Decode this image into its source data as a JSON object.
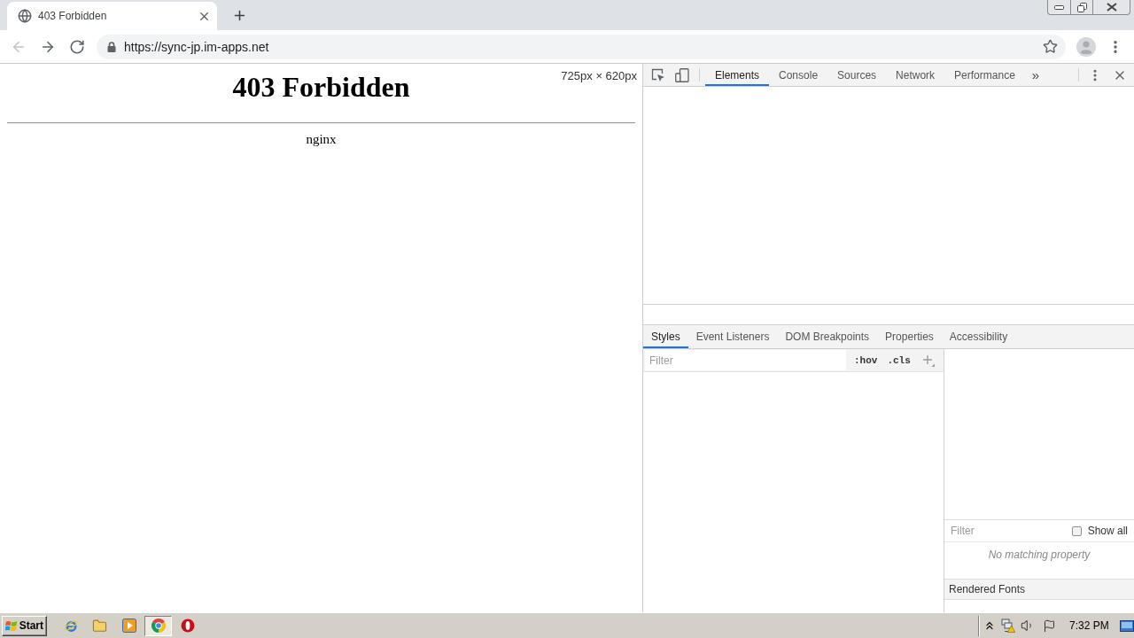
{
  "browser": {
    "tabs": [
      {
        "title": "403 Forbidden",
        "selected": true
      }
    ],
    "nav_buttons": [
      {
        "kind": "back",
        "disabled": true
      },
      {
        "kind": "forward",
        "disabled": false
      },
      {
        "kind": "reload",
        "disabled": false
      }
    ],
    "address_bar": {
      "url": "https://sync-jp.im-apps.net"
    }
  },
  "page": {
    "heading": "403 Forbidden",
    "server": "nginx",
    "size_overlay": "725px × 620px"
  },
  "devtools": {
    "tabs": [
      {
        "label": "Elements",
        "selected": true
      },
      {
        "label": "Console",
        "selected": false
      },
      {
        "label": "Sources",
        "selected": false
      },
      {
        "label": "Network",
        "selected": false
      },
      {
        "label": "Performance",
        "selected": false
      }
    ],
    "more_tabs": "»",
    "sidebar_tabs": [
      {
        "label": "Styles",
        "selected": true
      },
      {
        "label": "Event Listeners",
        "selected": false
      },
      {
        "label": "DOM Breakpoints",
        "selected": false
      },
      {
        "label": "Properties",
        "selected": false
      },
      {
        "label": "Accessibility",
        "selected": false
      }
    ],
    "styles": {
      "filter": {
        "placeholder": "Filter"
      },
      "hov": ":hov",
      "cls": ".cls"
    },
    "computed": {
      "filter": {
        "placeholder": "Filter"
      },
      "show_all": {
        "label": "Show all",
        "checked": false
      },
      "empty_message": "No matching property",
      "section": "Rendered Fonts"
    }
  },
  "taskbar": {
    "start": "Start",
    "apps": [
      {
        "kind": "ie",
        "selected": false
      },
      {
        "kind": "folder",
        "selected": false
      },
      {
        "kind": "media",
        "selected": false
      },
      {
        "kind": "chrome",
        "selected": true
      },
      {
        "kind": "opera",
        "selected": false
      }
    ],
    "clock": "7:32 PM"
  }
}
